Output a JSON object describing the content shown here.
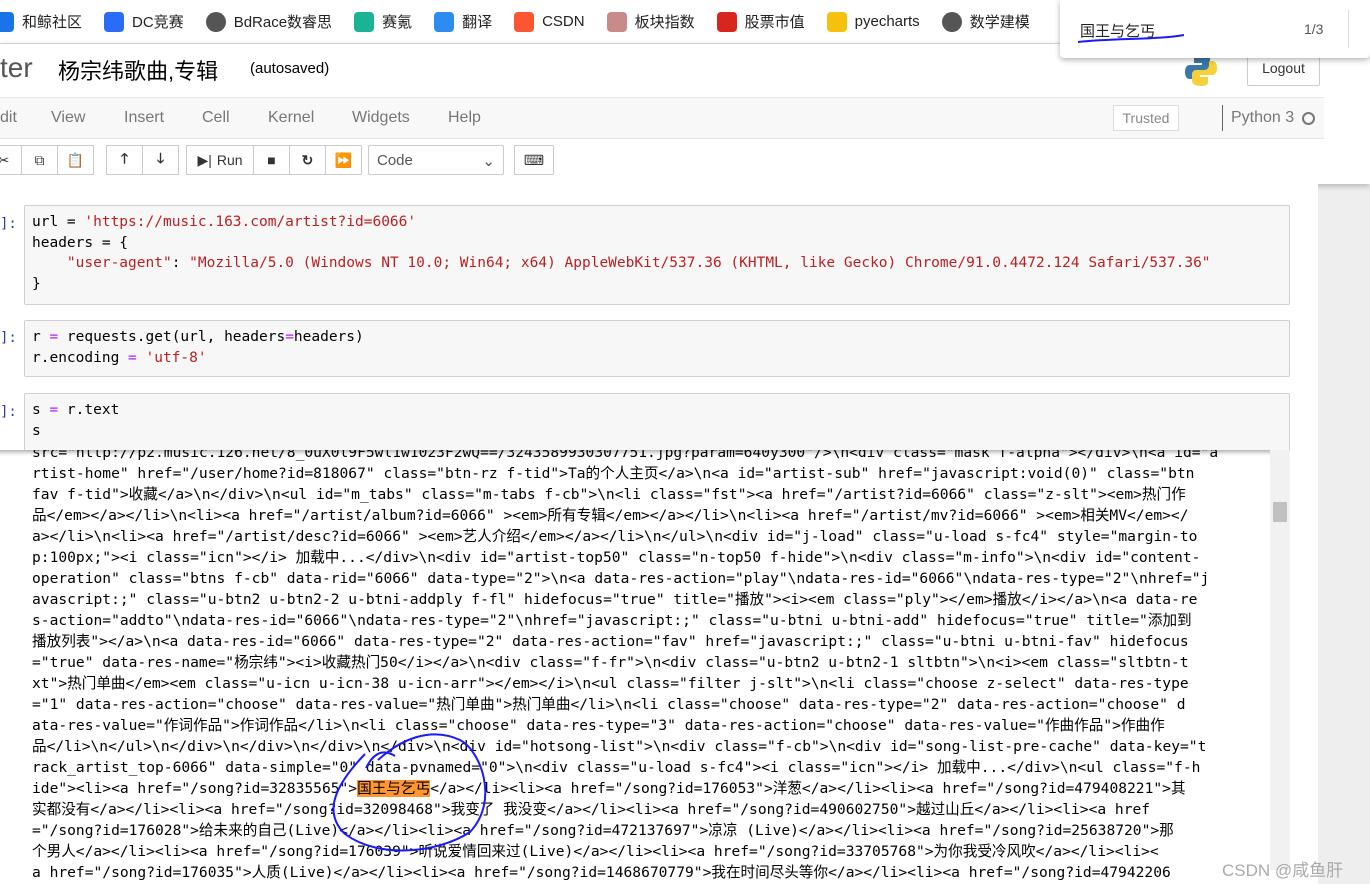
{
  "bookmarks": [
    {
      "label": "和鲸社区",
      "icon": "heywhale-icon",
      "color": "#1a73e8"
    },
    {
      "label": "DC竞赛",
      "icon": "dc-icon",
      "color": "#2b6cf6"
    },
    {
      "label": "BdRace数睿思",
      "icon": "globe-icon",
      "color": "#555555"
    },
    {
      "label": "赛氪",
      "icon": "saikr-icon",
      "color": "#1ab394"
    },
    {
      "label": "翻译",
      "icon": "translate-icon",
      "color": "#2d8cf0"
    },
    {
      "label": "CSDN",
      "icon": "csdn-icon",
      "color": "#fc5531"
    },
    {
      "label": "板块指数",
      "icon": "sector-icon",
      "color": "#c98a8a"
    },
    {
      "label": "股票市值",
      "icon": "stock-icon",
      "color": "#d7261e"
    },
    {
      "label": "pyecharts",
      "icon": "pyecharts-icon",
      "color": "#f4c20d"
    },
    {
      "label": "数学建模",
      "icon": "globe-icon",
      "color": "#555555"
    }
  ],
  "find": {
    "query": "国王与乞丐",
    "count": "1/3"
  },
  "header": {
    "logo_partial": "ter",
    "title": "杨宗纬歌曲,专辑",
    "status": "(autosaved)",
    "logout": "Logout"
  },
  "menu": [
    "dit",
    "View",
    "Insert",
    "Cell",
    "Kernel",
    "Widgets",
    "Help"
  ],
  "trusted": "Trusted",
  "kernel": "Python 3",
  "toolbar": {
    "run": "Run",
    "cell_type": "Code"
  },
  "cells": [
    {
      "prompt": "]:"
    },
    {
      "prompt": "]:"
    },
    {
      "prompt": "]:"
    }
  ],
  "code": {
    "c1l1a": "url = ",
    "c1l1b": "'https://music.163.com/artist?id=6066'",
    "c1l2a": "headers = {",
    "c1l3a": "    ",
    "c1l3b": "\"user-agent\"",
    "c1l3c": ": ",
    "c1l3d": "\"Mozilla/5.0 (Windows NT 10.0; Win64; x64) AppleWebKit/537.36 (KHTML, like Gecko) Chrome/91.0.4472.124 Safari/537.36\"",
    "c1l4a": "}",
    "c2l1a": "r ",
    "c2l1b": "=",
    "c2l1c": " requests.get(url, headers",
    "c2l1d": "=",
    "c2l1e": "headers)",
    "c2l2a": "r.encoding ",
    "c2l2b": "=",
    "c2l2c": " ",
    "c2l2d": "'utf-8'",
    "c3l1a": "s ",
    "c3l1b": "=",
    "c3l1c": " r.text",
    "c3l2a": "s"
  },
  "output": {
    "lines": [
      "src=\"http://p2.music.126.net/8_0uX0l9F5wl1w1023F2wQ==/3243589930307751.jpg?param=640y300\"/>\\n<div class=\"mask f-alpha\"></div>\\n<a id=\"a",
      "rtist-home\" href=\"/user/home?id=818067\" class=\"btn-rz f-tid\">Ta的个人主页</a>\\n<a id=\"artist-sub\" href=\"javascript:void(0)\" class=\"btn",
      "fav f-tid\">收藏</a>\\n</div>\\n<ul id=\"m_tabs\" class=\"m-tabs f-cb\">\\n<li class=\"fst\"><a href=\"/artist?id=6066\" class=\"z-slt\"><em>热门作",
      "品</em></a></li>\\n<li><a href=\"/artist/album?id=6066\" ><em>所有专辑</em></a></li>\\n<li><a href=\"/artist/mv?id=6066\" ><em>相关MV</em></",
      "a></li>\\n<li><a href=\"/artist/desc?id=6066\" ><em>艺人介绍</em></a></li>\\n</ul>\\n<div id=\"j-load\" class=\"u-load s-fc4\" style=\"margin-to",
      "p:100px;\"><i class=\"icn\"></i> 加载中...</div>\\n<div id=\"artist-top50\" class=\"n-top50 f-hide\">\\n<div class=\"m-info\">\\n<div id=\"content-",
      "operation\" class=\"btns f-cb\" data-rid=\"6066\" data-type=\"2\">\\n<a data-res-action=\"play\"\\ndata-res-id=\"6066\"\\ndata-res-type=\"2\"\\nhref=\"j",
      "avascript:;\" class=\"u-btn2 u-btn2-2 u-btni-addply f-fl\" hidefocus=\"true\" title=\"播放\"><i><em class=\"ply\"></em>播放</i></a>\\n<a data-re",
      "s-action=\"addto\"\\ndata-res-id=\"6066\"\\ndata-res-type=\"2\"\\nhref=\"javascript:;\" class=\"u-btni u-btni-add\" hidefocus=\"true\" title=\"添加到",
      "播放列表\"></a>\\n<a data-res-id=\"6066\" data-res-type=\"2\" data-res-action=\"fav\" href=\"javascript:;\" class=\"u-btni u-btni-fav\" hidefocus",
      "=\"true\" data-res-name=\"杨宗纬\"><i>收藏热门50</i></a>\\n<div class=\"f-fr\">\\n<div class=\"u-btn2 u-btn2-1 sltbtn\">\\n<i><em class=\"sltbtn-t",
      "xt\">热门单曲</em><em class=\"u-icn u-icn-38 u-icn-arr\"></em></i>\\n<ul class=\"filter j-slt\">\\n<li class=\"choose z-select\" data-res-type",
      "=\"1\" data-res-action=\"choose\" data-res-value=\"热门单曲\">热门单曲</li>\\n<li class=\"choose\" data-res-type=\"2\" data-res-action=\"choose\" d",
      "ata-res-value=\"作词作品\">作词作品</li>\\n<li class=\"choose\" data-res-type=\"3\" data-res-action=\"choose\" data-res-value=\"作曲作品\">作曲作",
      "品</li>\\n</ul>\\n</div>\\n</div>\\n</div>\\n</div>\\n<div id=\"hotsong-list\">\\n<div class=\"f-cb\">\\n<div id=\"song-list-pre-cache\" data-key=\"t",
      "rack_artist_top-6066\" data-simple=\"0\" data-pvnamed=\"0\">\\n<div class=\"u-load s-fc4\"><i class=\"icn\"></i> 加载中...</div>\\n<ul class=\"f-h"
    ],
    "match_line": {
      "before": "ide\"><li><a href=\"/song?id=32835565\">",
      "match": "国王与乞丐",
      "after": "</a></li><li><a href=\"/song?id=176053\">洋葱</a></li><li><a href=\"/song?id=479408221\">其"
    },
    "lines_after": [
      "实都没有</a></li><li><a href=\"/song?id=32098468\">我变了 我没变</a></li><li><a href=\"/song?id=490602750\">越过山丘</a></li><li><a href",
      "=\"/song?id=176028\">给未来的自己(Live)</a></li><li><a href=\"/song?id=472137697\">凉凉 (Live)</a></li><li><a href=\"/song?id=25638720\">那",
      "个男人</a></li><li><a href=\"/song?id=176039\">听说爱情回来过(Live)</a></li><li><a href=\"/song?id=33705768\">为你我受冷风吹</a></li><li><",
      "a href=\"/song?id=176035\">人质(Live)</a></li><li><a href=\"/song?id=1468670779\">我在时间尽头等你</a></li><li><a href=\"/song?id=47942206"
    ],
    "highlight_color": "#ff9632",
    "annotation_color": "#1a1aff"
  },
  "watermark": "CSDN @咸鱼肝"
}
